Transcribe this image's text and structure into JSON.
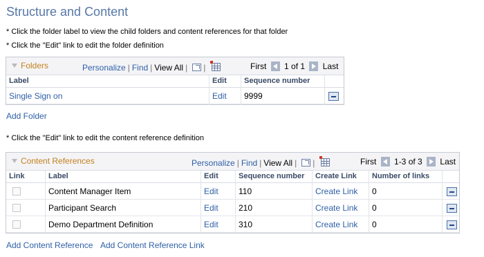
{
  "page": {
    "title": "Structure and Content",
    "notes": {
      "line1": "* Click the folder label to view the child folders and content references for that folder",
      "line2": "* Click the \"Edit\" link to edit the folder definition",
      "line3": "* Click the \"Edit\" link to edit the content reference definition"
    }
  },
  "folders_grid": {
    "title": "Folders",
    "tools": {
      "personalize": "Personalize",
      "find": "Find",
      "view_all": "View All"
    },
    "pager": {
      "first": "First",
      "range": "1 of 1",
      "last": "Last"
    },
    "columns": {
      "label": "Label",
      "edit": "Edit",
      "sequence": "Sequence number"
    },
    "rows": [
      {
        "label": "Single Sign on",
        "edit": "Edit",
        "sequence": "9999"
      }
    ],
    "add_link": "Add Folder"
  },
  "content_grid": {
    "title": "Content References",
    "tools": {
      "personalize": "Personalize",
      "find": "Find",
      "view_all": "View All"
    },
    "pager": {
      "first": "First",
      "range": "1-3 of 3",
      "last": "Last"
    },
    "columns": {
      "link": "Link",
      "label": "Label",
      "edit": "Edit",
      "sequence": "Sequence number",
      "create_link": "Create Link",
      "num_links": "Number of links"
    },
    "rows": [
      {
        "label": "Content Manager Item",
        "edit": "Edit",
        "sequence": "110",
        "create_link": "Create Link",
        "num_links": "0"
      },
      {
        "label": "Participant Search",
        "edit": "Edit",
        "sequence": "210",
        "create_link": "Create Link",
        "num_links": "0"
      },
      {
        "label": "Demo Department Definition",
        "edit": "Edit",
        "sequence": "310",
        "create_link": "Create Link",
        "num_links": "0"
      }
    ]
  },
  "footer_links": {
    "add_content_reference": "Add Content Reference",
    "add_content_reference_link": "Add Content Reference Link"
  },
  "icons": [
    "collapse-triangle-icon",
    "new-window-icon",
    "download-grid-icon",
    "prev-page-icon",
    "next-page-icon",
    "delete-row-icon"
  ],
  "colors": {
    "title": "#5778a8",
    "link": "#2e5fa6",
    "grid_title": "#c47f1a",
    "grid_header_bg": "#f4f4f7"
  }
}
